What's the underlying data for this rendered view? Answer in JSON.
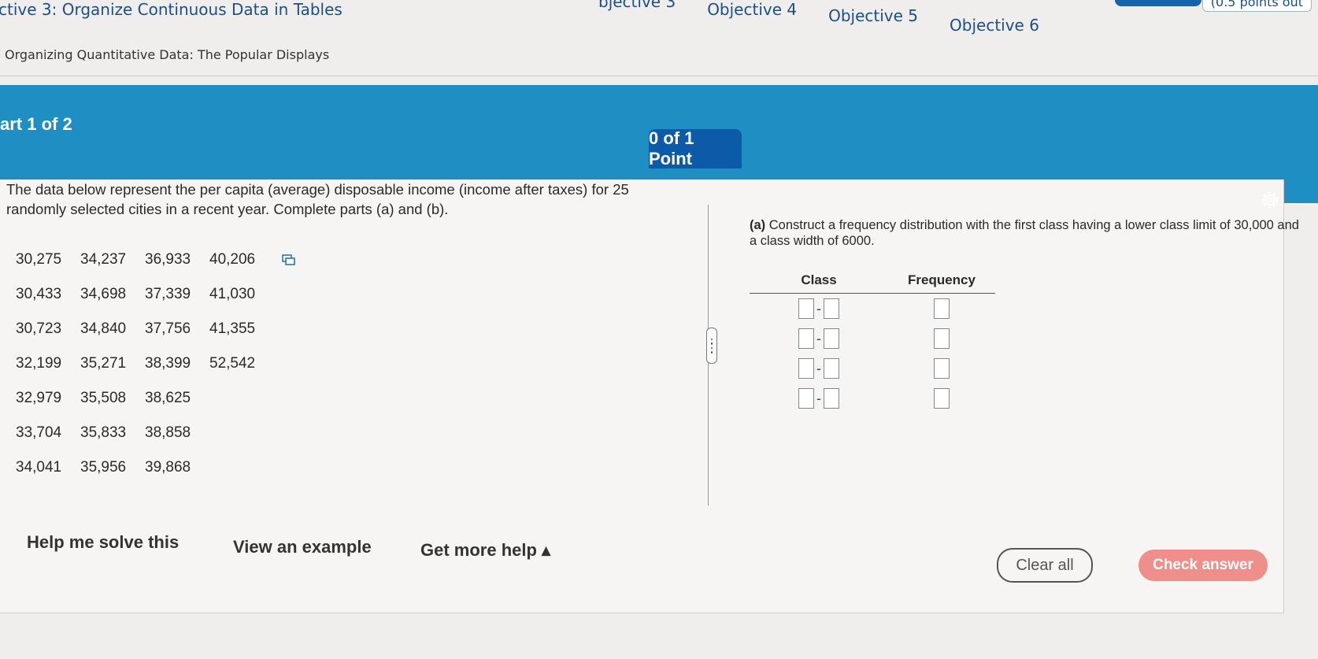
{
  "header": {
    "objective_title": "ctive 3: Organize Continuous Data in Tables",
    "section_title": "Organizing Quantitative Data: The Popular Displays",
    "objective_tabs": [
      {
        "label": "bjective 3"
      },
      {
        "label": "Objective 4"
      },
      {
        "label": "Objective 5"
      },
      {
        "label": "Objective 6"
      }
    ],
    "points_text": "(0.5 points out"
  },
  "question_bar": {
    "part_label": "art 1 of 2",
    "points_label": "0 of 1 Point"
  },
  "problem": {
    "intro": "The data below represent the per capita (average) disposable income (income after taxes) for 25 randomly selected cities in a recent year. Complete parts (a) and (b).",
    "data_rows": [
      [
        "30,275",
        "34,237",
        "36,933",
        "40,206"
      ],
      [
        "30,433",
        "34,698",
        "37,339",
        "41,030"
      ],
      [
        "30,723",
        "34,840",
        "37,756",
        "41,355"
      ],
      [
        "32,199",
        "35,271",
        "38,399",
        "52,542"
      ],
      [
        "32,979",
        "35,508",
        "38,625"
      ],
      [
        "33,704",
        "35,833",
        "38,858"
      ],
      [
        "34,041",
        "35,956",
        "39,868"
      ]
    ]
  },
  "part_a": {
    "label": "(a)",
    "prompt": "Construct a frequency distribution with the first class having a lower class limit of 30,000 and a class width of 6000.",
    "table_headers": {
      "class": "Class",
      "frequency": "Frequency"
    },
    "row_count": 4
  },
  "footer": {
    "help_me_solve": "Help me solve this",
    "view_example": "View an example",
    "get_more_help": "Get more help ▴",
    "clear_all": "Clear all",
    "check_answer": "Check answer"
  },
  "colors": {
    "accent_blue": "#1f8ec3",
    "badge_blue": "#0d5aa8",
    "check_button": "#ee8f8b"
  }
}
